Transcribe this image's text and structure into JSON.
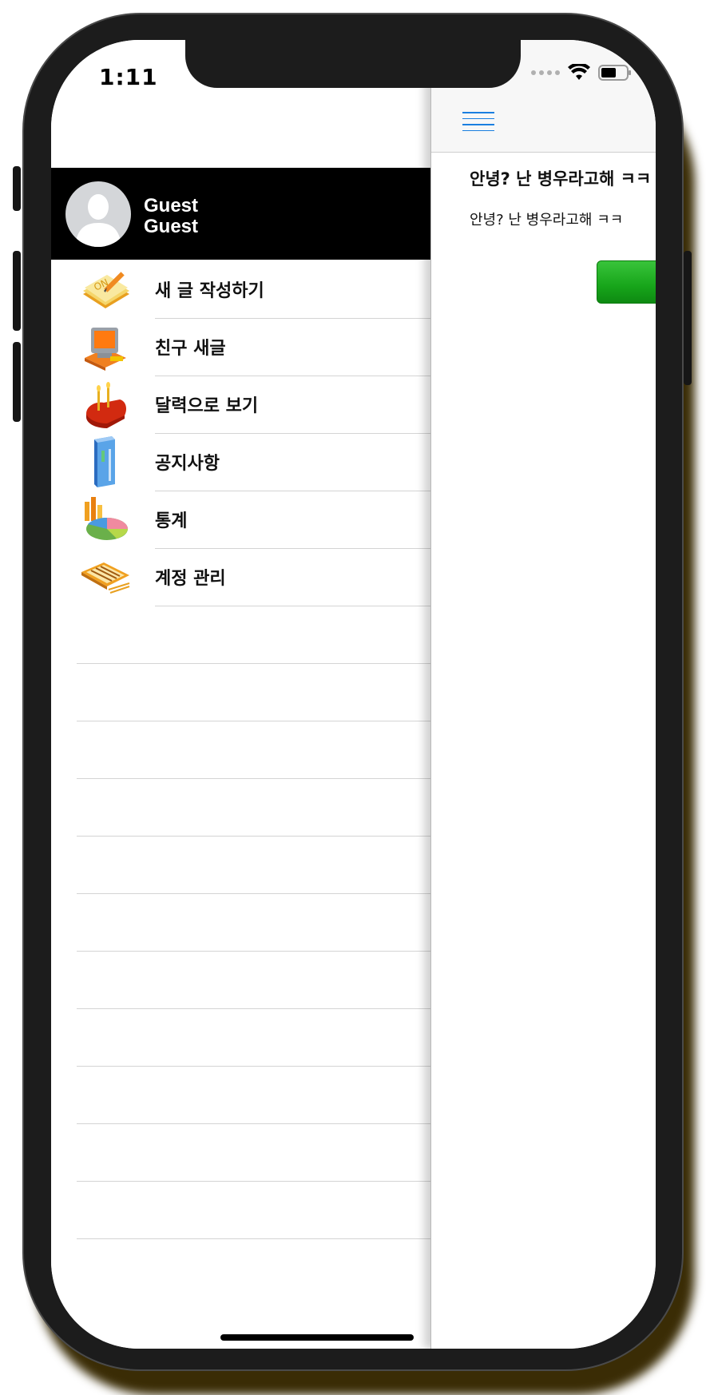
{
  "status_bar": {
    "time": "1:11"
  },
  "drawer": {
    "user": {
      "name_line1": "Guest",
      "name_line2": "Guest"
    },
    "menu_items": [
      {
        "label": "새 글 작성하기",
        "icon": "notepad-pencil-icon"
      },
      {
        "label": "친구 새글",
        "icon": "computer-icon"
      },
      {
        "label": "달력으로 보기",
        "icon": "cake-candles-icon"
      },
      {
        "label": "공지사항",
        "icon": "server-tower-icon"
      },
      {
        "label": "통계",
        "icon": "pie-chart-icon"
      },
      {
        "label": "계정 관리",
        "icon": "abacus-icon"
      }
    ]
  },
  "main": {
    "menu_button_icon": "hamburger-menu-icon",
    "post": {
      "title": "안녕? 난 병우라고해 ㅋㅋ",
      "body": "안녕? 난 병우라고해 ㅋㅋ"
    }
  },
  "colors": {
    "header_bg": "#000000",
    "accent_blue": "#1a7fe0",
    "button_green": "#17a51a"
  }
}
